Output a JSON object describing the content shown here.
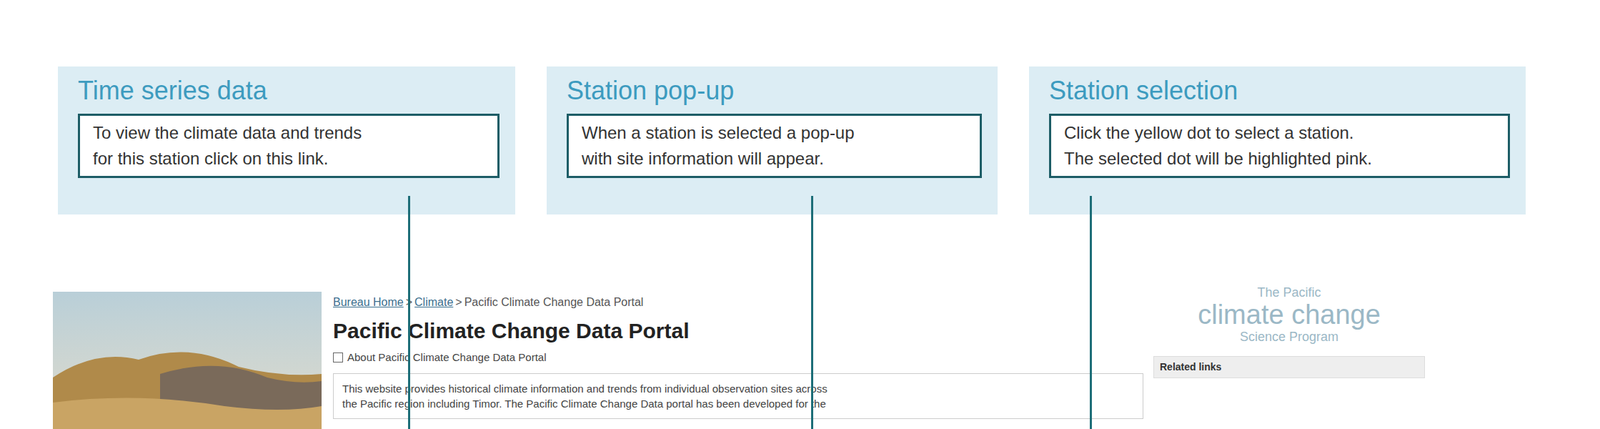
{
  "callouts": [
    {
      "title": "Time series data",
      "lines": [
        "To view the climate data and trends",
        "for this station click on this link."
      ]
    },
    {
      "title": "Station pop-up",
      "lines": [
        "When a station is selected a pop-up",
        "with site information will appear."
      ]
    },
    {
      "title": "Station selection",
      "lines": [
        "Click the yellow dot to select a station.",
        "The selected dot will be highlighted pink."
      ]
    }
  ],
  "portal": {
    "breadcrumb": [
      {
        "label": "Bureau Home",
        "link": true
      },
      {
        "label": ">",
        "link": false
      },
      {
        "label": "Climate",
        "link": true
      },
      {
        "label": ">",
        "link": false
      },
      {
        "label": "Pacific Climate Change Data Portal",
        "link": false
      }
    ],
    "title": "Pacific Climate Change Data Portal",
    "about": "About Pacific Climate Change Data Portal",
    "intro": [
      "This website provides historical climate information and trends from individual observation sites across",
      "the Pacific region including Timor. The Pacific Climate Change Data portal has been developed for the"
    ],
    "logo": {
      "top": "The Pacific",
      "main": "climate change",
      "bottom": "Science Program"
    },
    "related": {
      "title": "Related links"
    }
  }
}
